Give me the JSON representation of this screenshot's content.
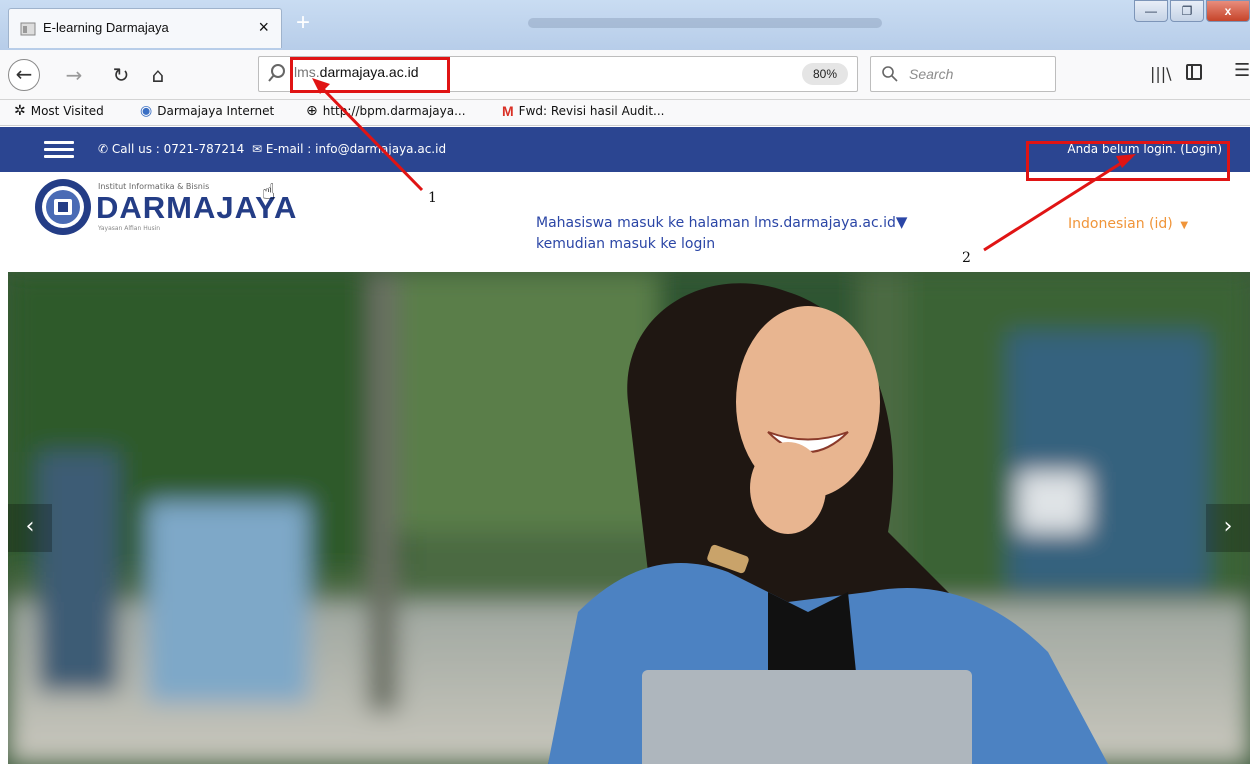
{
  "browser": {
    "tab_title": "E-learning Darmajaya",
    "tab_close": "×",
    "new_tab": "+",
    "url_prefix": "lms.",
    "url_domain": "darmajaya.ac.id",
    "zoom": "80%",
    "search_placeholder": "Search",
    "bookmarks": [
      {
        "icon": "gear-icon",
        "label": "Most Visited"
      },
      {
        "icon": "globe-icon",
        "label": "Darmajaya Internet"
      },
      {
        "icon": "web-icon",
        "label": "http://bpm.darmajaya..."
      },
      {
        "icon": "gmail-icon",
        "label": "Fwd: Revisi hasil Audit..."
      }
    ]
  },
  "site": {
    "contact_call": "Call us : 0721-787214",
    "contact_email": "E-mail : info@darmajaya.ac.id",
    "login_status": "Anda belum login. (Login)",
    "logo_small": "Institut Informatika & Bisnis",
    "logo_name": "DARMAJAYA",
    "logo_tag": "Yayasan Alfian Husin",
    "note_line1": "Mahasiswa masuk ke halaman lms.darmajaya.ac.id",
    "note_line2": "kemudian masuk ke login",
    "language": "Indonesian (id)"
  },
  "annotations": {
    "marker_1": "1",
    "marker_2": "2",
    "color": "#e01414"
  },
  "carousel": {
    "prev": "‹",
    "next": "›"
  }
}
